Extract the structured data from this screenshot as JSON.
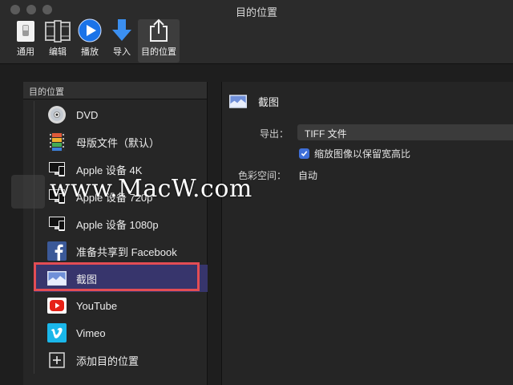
{
  "window": {
    "title": "目的位置"
  },
  "toolbar": {
    "items": [
      {
        "label": "通用",
        "icon": "switch-icon"
      },
      {
        "label": "编辑",
        "icon": "film-edit-icon"
      },
      {
        "label": "播放",
        "icon": "play-icon"
      },
      {
        "label": "导入",
        "icon": "download-arrow-icon"
      },
      {
        "label": "目的位置",
        "icon": "share-icon"
      }
    ]
  },
  "sidebar": {
    "header": "目的位置",
    "items": [
      {
        "label": "DVD",
        "icon": "dvd-icon"
      },
      {
        "label": "母版文件（默认）",
        "icon": "film-strip-icon"
      },
      {
        "label": "Apple 设备 4K",
        "icon": "apple-devices-icon"
      },
      {
        "label": "Apple 设备 720p",
        "icon": "apple-devices-icon"
      },
      {
        "label": "Apple 设备 1080p",
        "icon": "apple-devices-icon"
      },
      {
        "label": "准备共享到 Facebook",
        "icon": "facebook-icon"
      },
      {
        "label": "截图",
        "icon": "screenshot-icon"
      },
      {
        "label": "YouTube",
        "icon": "youtube-icon"
      },
      {
        "label": "Vimeo",
        "icon": "vimeo-icon"
      },
      {
        "label": "添加目的位置",
        "icon": "add-icon"
      }
    ],
    "selected_index": 6
  },
  "detail": {
    "title": "截图",
    "export_label": "导出：",
    "export_value": "TIFF 文件",
    "checkbox_label": "缩放图像以保留宽高比",
    "checkbox_checked": true,
    "color_space_label": "色彩空间：",
    "color_space_value": "自动"
  },
  "watermark": {
    "text": "www.MacW.com"
  },
  "colors": {
    "selection": "#37356c",
    "highlight_outline": "#e34d54",
    "checkbox": "#3f6fd8",
    "accent_blue": "#1a73e8"
  }
}
